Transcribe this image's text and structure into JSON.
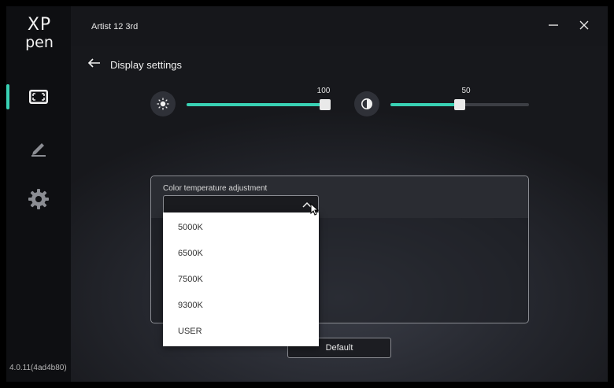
{
  "app": {
    "logo_line1": "XP",
    "logo_line2": "pen",
    "title": "Artist 12 3rd",
    "version": "4.0.11(4ad4b80)"
  },
  "sidebar": {
    "items": [
      {
        "name": "display",
        "icon": "fullscreen-icon",
        "active": true
      },
      {
        "name": "pen",
        "icon": "pen-icon",
        "active": false
      },
      {
        "name": "settings",
        "icon": "gear-icon",
        "active": false
      }
    ]
  },
  "page": {
    "title": "Display settings"
  },
  "brightness": {
    "icon": "brightness-icon",
    "value": "100",
    "max": 100
  },
  "contrast": {
    "icon": "contrast-icon",
    "value": "50",
    "max": 100
  },
  "color_temperature": {
    "label": "Color temperature adjustment",
    "selected": "",
    "options": [
      "5000K",
      "6500K",
      "7500K",
      "9300K",
      "USER"
    ]
  },
  "default_button": "Default",
  "colors": {
    "accent": "#39d1b4",
    "background": "#15161a",
    "sidebar": "#0e0f12"
  }
}
